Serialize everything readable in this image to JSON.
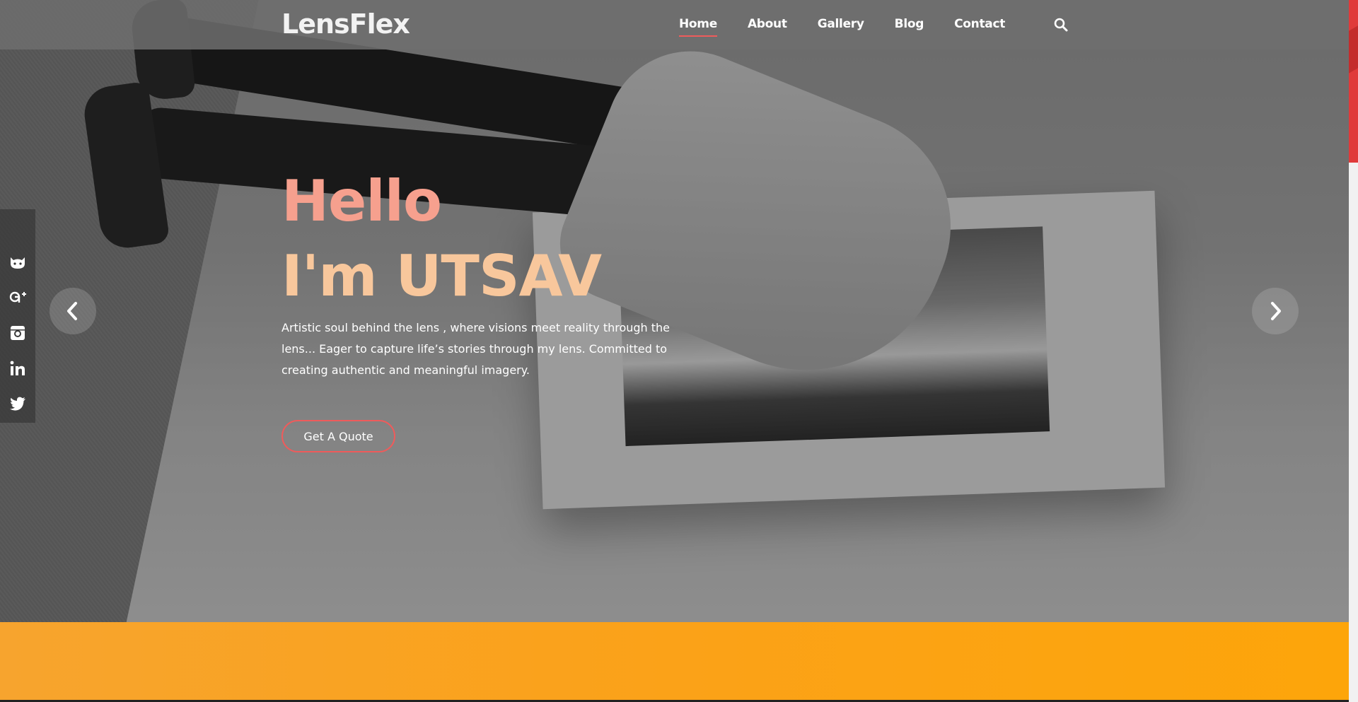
{
  "header": {
    "logo": "LensFlex",
    "nav": [
      {
        "label": "Home",
        "active": true
      },
      {
        "label": "About",
        "active": false
      },
      {
        "label": "Gallery",
        "active": false
      },
      {
        "label": "Blog",
        "active": false
      },
      {
        "label": "Contact",
        "active": false
      }
    ],
    "search_icon": "search-icon"
  },
  "social": [
    "github-icon",
    "google-plus-icon",
    "instagram-icon",
    "linkedin-icon",
    "twitter-icon"
  ],
  "hero": {
    "line1": "Hello",
    "line2": "I'm UTSAV",
    "tagline": "Artistic soul behind the lens , where visions meet reality through the lens... Eager to capture life’s stories through my lens. Committed to creating authentic and meaningful imagery.",
    "cta": "Get A Quote",
    "prev_icon": "chevron-left-icon",
    "next_icon": "chevron-right-icon"
  },
  "colors": {
    "accent": "#ef5b5b",
    "title_line1": "#f6a08e",
    "title_line2": "#f8c79c",
    "band": "#fba218"
  }
}
